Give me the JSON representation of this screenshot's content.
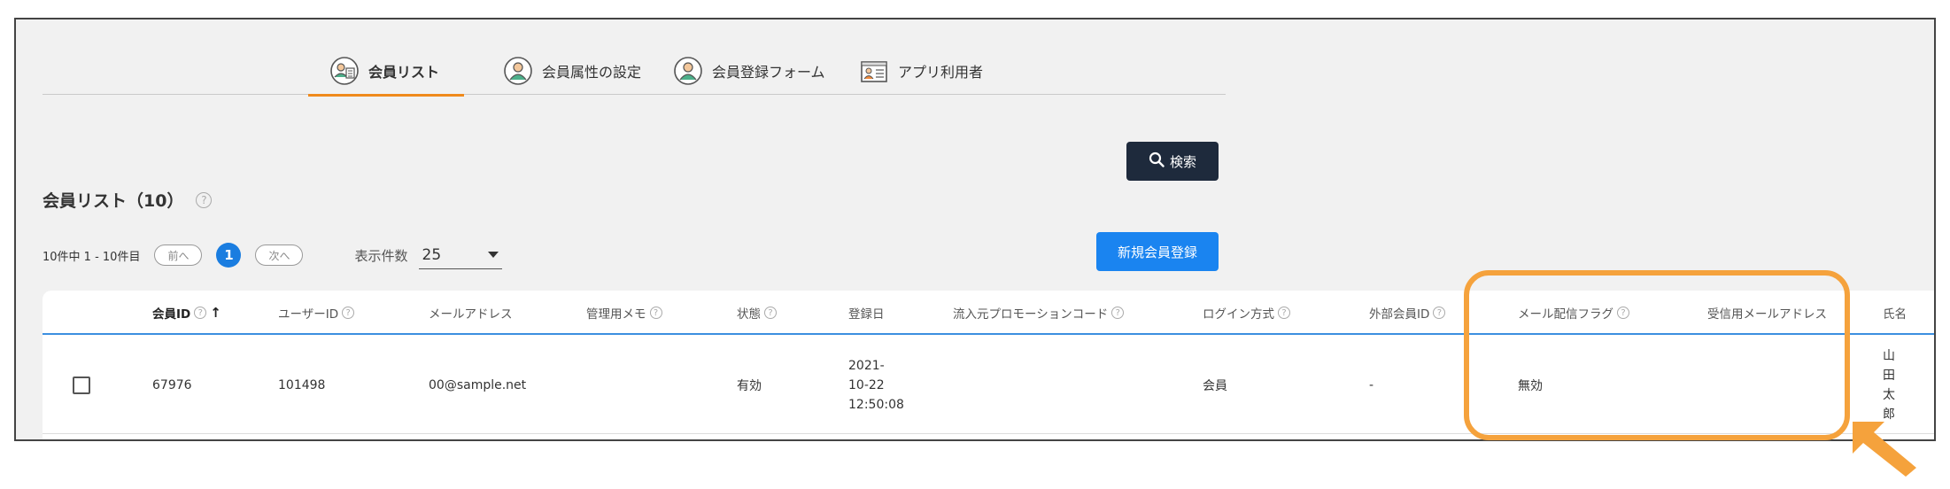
{
  "tabs": [
    {
      "label": "会員リスト",
      "icon": "member-list-icon",
      "active": true
    },
    {
      "label": "会員属性の設定",
      "icon": "person-circle-icon",
      "active": false
    },
    {
      "label": "会員登録フォーム",
      "icon": "person-circle-icon",
      "active": false
    },
    {
      "label": "アプリ利用者",
      "icon": "id-card-icon",
      "active": false
    }
  ],
  "search": {
    "label": "検索",
    "icon": "search-icon"
  },
  "list": {
    "title": "会員リスト（10）"
  },
  "pager": {
    "range": "10件中 1 - 10件目",
    "prev": "前へ",
    "current": "1",
    "next": "次へ",
    "per_page_label": "表示件数",
    "per_page_value": "25"
  },
  "new_button": "新規会員登録",
  "table": {
    "headers": [
      {
        "label": "会員ID",
        "help": true,
        "sort": "↑"
      },
      {
        "label": "ユーザーID",
        "help": true
      },
      {
        "label": "メールアドレス",
        "help": false
      },
      {
        "label": "管理用メモ",
        "help": true
      },
      {
        "label": "状態",
        "help": true
      },
      {
        "label": "登録日",
        "help": false
      },
      {
        "label": "流入元プロモーションコード",
        "help": true
      },
      {
        "label": "ログイン方式",
        "help": true
      },
      {
        "label": "外部会員ID",
        "help": true
      },
      {
        "label": "メール配信フラグ",
        "help": true
      },
      {
        "label": "受信用メールアドレス",
        "help": false
      },
      {
        "label": "氏名",
        "help": false
      }
    ],
    "rows": [
      {
        "member_id": "67976",
        "user_id": "101498",
        "email": "00@sample.net",
        "memo": "",
        "status": "有効",
        "registered": [
          "2021-",
          "10-22",
          "12:50:08"
        ],
        "promo_code": "",
        "login_method": "会員",
        "external_id": "-",
        "mail_flag": "無効",
        "receive_email": "",
        "name": "山田太郎"
      }
    ]
  },
  "colors": {
    "accent_orange": "#f5a23c",
    "tab_underline": "#ef8a1c",
    "primary_blue": "#1a84f0",
    "dark_button": "#1e2a3c"
  }
}
